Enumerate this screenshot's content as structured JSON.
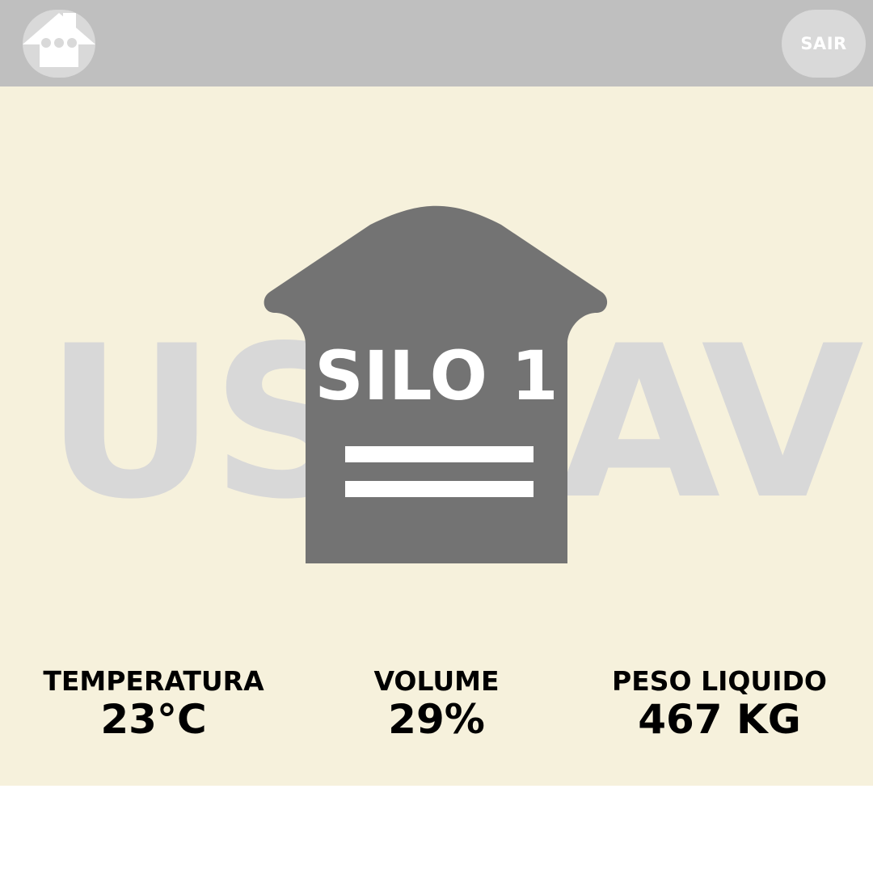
{
  "header": {
    "home_icon": "home-icon",
    "exit_label": "SAIR"
  },
  "main": {
    "watermark_left": "US",
    "watermark_right": "AV",
    "silo_title": "SILO 1",
    "silo_icon": "silo-icon"
  },
  "stats": [
    {
      "label": "TEMPERATURA",
      "value": "23°C"
    },
    {
      "label": "VOLUME",
      "value": "29%"
    },
    {
      "label": "PESO LIQUIDO",
      "value": "467 KG"
    }
  ],
  "colors": {
    "topbar": "#bfbfbf",
    "button": "#d9d9d9",
    "background": "#f6f1dc",
    "silo": "#737373",
    "watermark": "#d8d8d8"
  }
}
